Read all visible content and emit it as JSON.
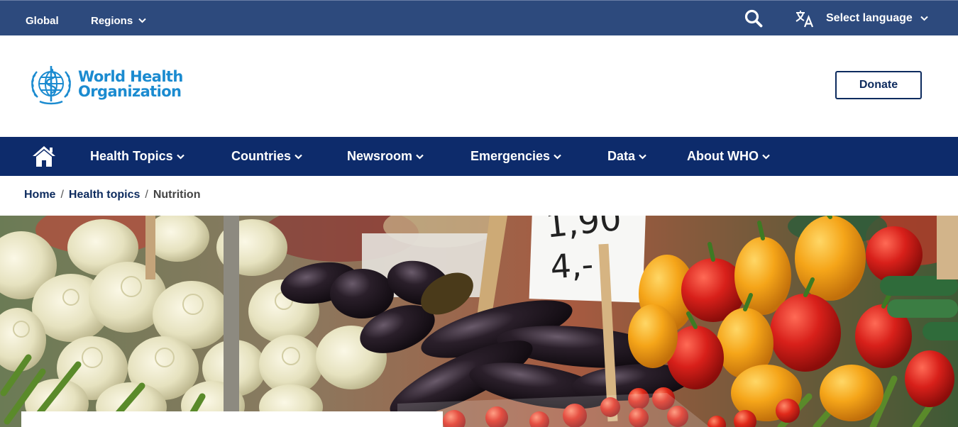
{
  "topbar": {
    "global_label": "Global",
    "regions_label": "Regions",
    "language_label": "Select language"
  },
  "header": {
    "logo_line1": "World Health",
    "logo_line2": "Organization",
    "donate_label": "Donate"
  },
  "nav": {
    "items": [
      {
        "label": "Health Topics"
      },
      {
        "label": "Countries"
      },
      {
        "label": "Newsroom"
      },
      {
        "label": "Emergencies"
      },
      {
        "label": "Data"
      },
      {
        "label": "About WHO"
      }
    ]
  },
  "breadcrumb": {
    "home": "Home",
    "health_topics": "Health topics",
    "current": "Nutrition"
  },
  "colors": {
    "topbar": "#2d4a7d",
    "nav": "#0d2b6b",
    "brand_blue": "#1b8bd0",
    "navy": "#0d2b5e"
  },
  "icons": {
    "search": "search-icon",
    "translate": "translate-icon",
    "home": "home-icon",
    "chevron": "chevron-down-icon"
  }
}
